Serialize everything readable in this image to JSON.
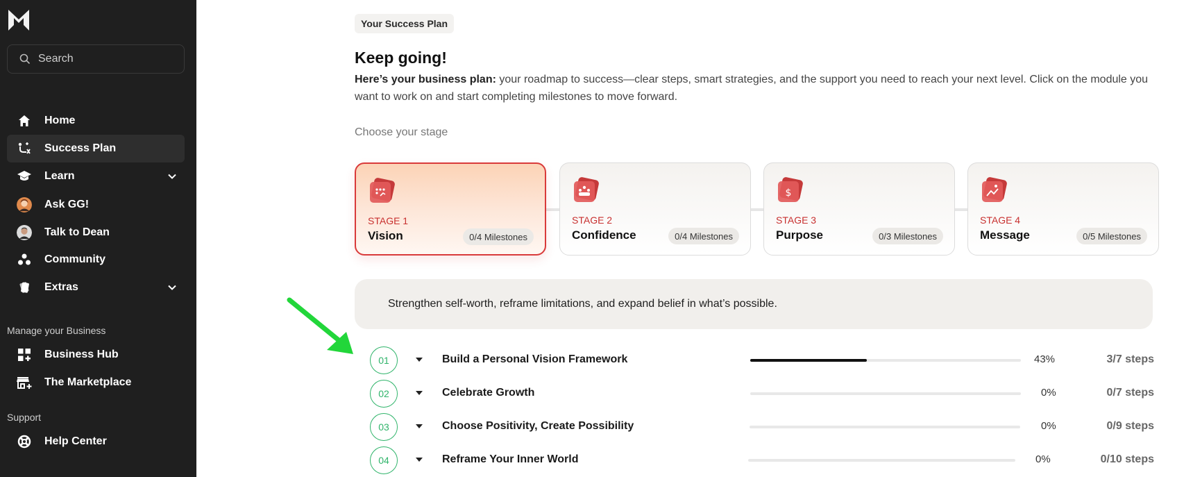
{
  "sidebar": {
    "search_placeholder": "Search",
    "items": [
      {
        "label": "Home",
        "icon": "home-icon"
      },
      {
        "label": "Success Plan",
        "icon": "route-icon",
        "active": true
      },
      {
        "label": "Learn",
        "icon": "graduation-cap-icon",
        "expandable": true
      },
      {
        "label": "Ask GG!",
        "icon": "avatar-gg"
      },
      {
        "label": "Talk to Dean",
        "icon": "avatar-dean"
      },
      {
        "label": "Community",
        "icon": "community-icon"
      },
      {
        "label": "Extras",
        "icon": "cards-icon",
        "expandable": true
      }
    ],
    "manage_label": "Manage your Business",
    "manage_items": [
      {
        "label": "Business Hub",
        "icon": "grid-plus-icon"
      },
      {
        "label": "The Marketplace",
        "icon": "store-icon"
      }
    ],
    "support_label": "Support",
    "support_items": [
      {
        "label": "Help Center",
        "icon": "lifebuoy-icon"
      }
    ]
  },
  "main": {
    "pill": "Your Success Plan",
    "title": "Keep going!",
    "description_bold": "Here’s your business plan:",
    "description_rest": " your roadmap to success—clear steps, smart strategies, and the support you need to reach your next level. Click on the module you want to work on and start completing milestones to move forward.",
    "choose_label": "Choose your stage",
    "stages": [
      {
        "label": "STAGE 1",
        "name": "Vision",
        "milestones": "0/4 Milestones",
        "active": true
      },
      {
        "label": "STAGE 2",
        "name": "Confidence",
        "milestones": "0/4 Milestones"
      },
      {
        "label": "STAGE 3",
        "name": "Purpose",
        "milestones": "0/3 Milestones"
      },
      {
        "label": "STAGE 4",
        "name": "Message",
        "milestones": "0/5 Milestones"
      }
    ],
    "banner": "Strengthen self-worth, reframe limitations, and expand belief in what’s possible.",
    "modules": [
      {
        "num": "01",
        "title": "Build a Personal Vision Framework",
        "progress": 0.43,
        "pct": "43%",
        "steps": "3/7 steps"
      },
      {
        "num": "02",
        "title": "Celebrate Growth",
        "progress": 0,
        "pct": "0%",
        "steps": "0/7 steps"
      },
      {
        "num": "03",
        "title": "Choose Positivity, Create Possibility",
        "progress": 0,
        "pct": "0%",
        "steps": "0/9 steps"
      },
      {
        "num": "04",
        "title": "Reframe Your Inner World",
        "progress": 0,
        "pct": "0%",
        "steps": "0/10 steps"
      }
    ]
  },
  "colors": {
    "sidebar_bg": "#1f1f1f",
    "accent_red": "#c8302f",
    "module_green": "#2fb46a",
    "arrow_green": "#22d63a"
  }
}
